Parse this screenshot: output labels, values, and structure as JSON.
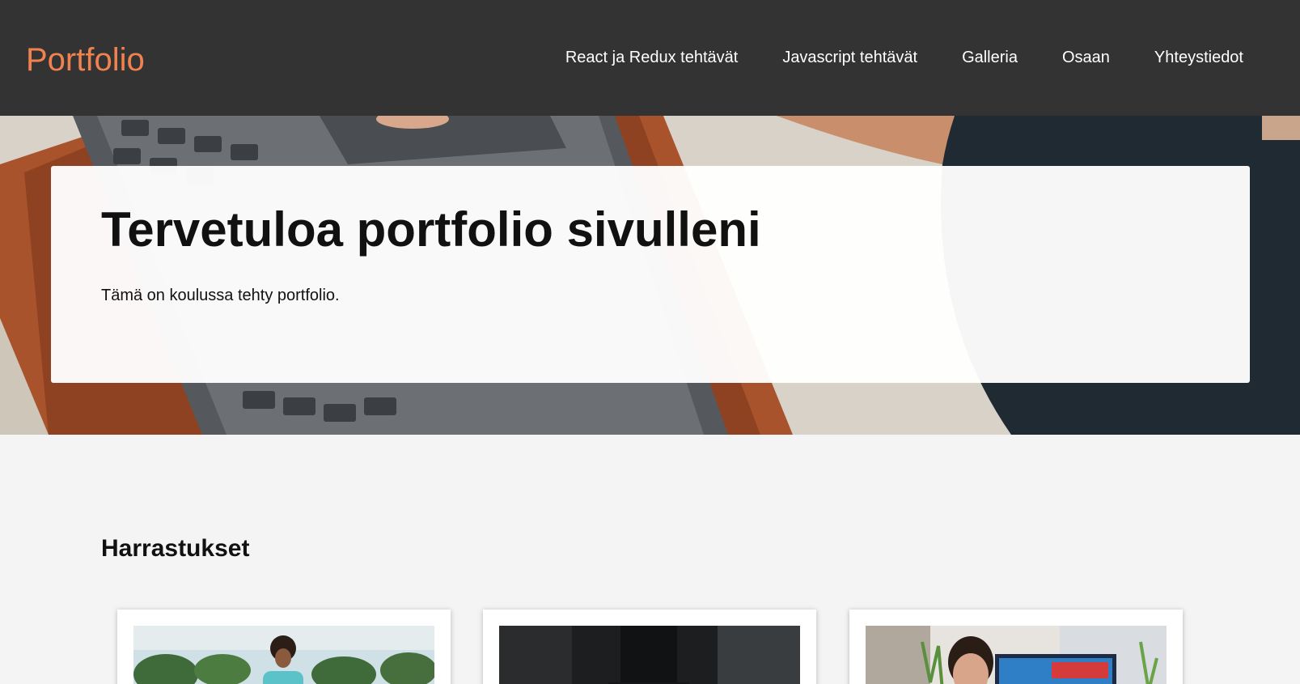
{
  "navbar": {
    "brand": "Portfolio",
    "links": [
      {
        "label": "React ja Redux tehtävät"
      },
      {
        "label": "Javascript tehtävät"
      },
      {
        "label": "Galleria"
      },
      {
        "label": "Osaan"
      },
      {
        "label": "Yhteystiedot"
      }
    ]
  },
  "hero": {
    "title": "Tervetuloa portfolio sivulleni",
    "text": "Tämä on koulussa tehty portfolio."
  },
  "hobbies": {
    "title": "Harrastukset",
    "cards": [
      {
        "image": "person-outdoors-photo"
      },
      {
        "image": "skateboarder-photo"
      },
      {
        "image": "person-at-computer-photo"
      }
    ]
  },
  "colors": {
    "navbar_bg": "#333333",
    "brand": "#f0824f",
    "nav_text": "#ffffff",
    "page_bg": "#f4f4f4"
  }
}
